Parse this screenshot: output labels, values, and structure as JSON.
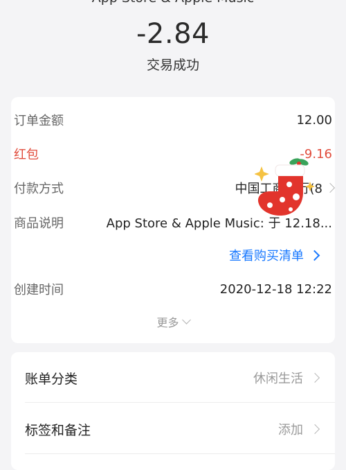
{
  "header": {
    "merchant": "App Store & Apple Music",
    "amount": "-2.84",
    "status": "交易成功"
  },
  "details": {
    "order_amount": {
      "label": "订单金额",
      "value": "12.00"
    },
    "red_packet": {
      "label": "红包",
      "value": "-9.16"
    },
    "payment_method": {
      "label": "付款方式",
      "value": "中国工商银行(8"
    },
    "product_desc": {
      "label": "商品说明",
      "value": "App Store & Apple Music: 于 12.18..."
    },
    "view_purchase_list": "查看购买清单",
    "created_time": {
      "label": "创建时间",
      "value": "2020-12-18 12:22"
    },
    "more": "更多"
  },
  "bottom": {
    "category": {
      "label": "账单分类",
      "value": "休闲生活"
    },
    "tags": {
      "label": "标签和备注",
      "value": "添加"
    }
  },
  "colors": {
    "accent_blue": "#1677ff",
    "red": "#e14c3c",
    "background": "#f4f4f6"
  }
}
